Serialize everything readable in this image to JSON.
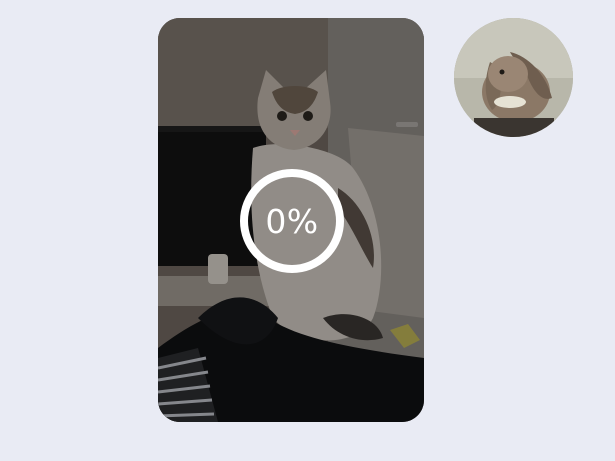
{
  "message": {
    "upload_progress_label": "0%",
    "upload_progress_fraction": 0.0,
    "attachment_type": "photo"
  },
  "avatar": {
    "icon": "rabbit-avatar"
  },
  "colors": {
    "background": "#e9ebf4",
    "progress_ring": "#ffffff"
  }
}
